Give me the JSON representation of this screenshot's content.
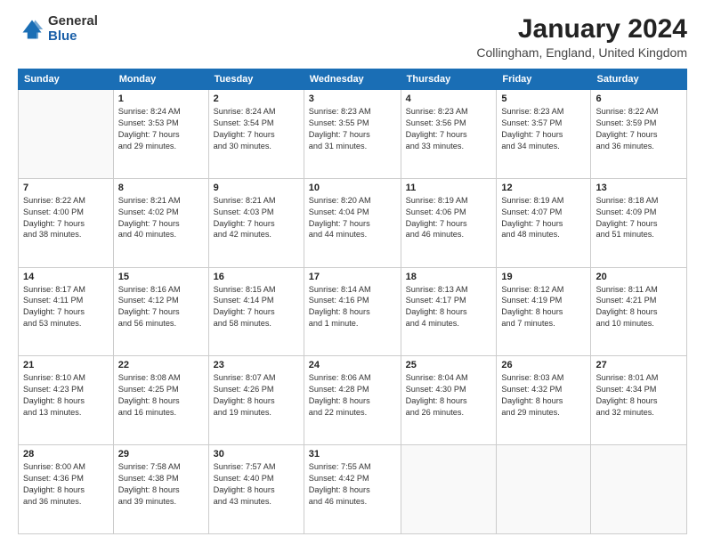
{
  "header": {
    "logo_general": "General",
    "logo_blue": "Blue",
    "month_title": "January 2024",
    "location": "Collingham, England, United Kingdom"
  },
  "days_of_week": [
    "Sunday",
    "Monday",
    "Tuesday",
    "Wednesday",
    "Thursday",
    "Friday",
    "Saturday"
  ],
  "weeks": [
    [
      {
        "day": "",
        "sunrise": "",
        "sunset": "",
        "daylight": ""
      },
      {
        "day": "1",
        "sunrise": "Sunrise: 8:24 AM",
        "sunset": "Sunset: 3:53 PM",
        "daylight": "Daylight: 7 hours and 29 minutes."
      },
      {
        "day": "2",
        "sunrise": "Sunrise: 8:24 AM",
        "sunset": "Sunset: 3:54 PM",
        "daylight": "Daylight: 7 hours and 30 minutes."
      },
      {
        "day": "3",
        "sunrise": "Sunrise: 8:23 AM",
        "sunset": "Sunset: 3:55 PM",
        "daylight": "Daylight: 7 hours and 31 minutes."
      },
      {
        "day": "4",
        "sunrise": "Sunrise: 8:23 AM",
        "sunset": "Sunset: 3:56 PM",
        "daylight": "Daylight: 7 hours and 33 minutes."
      },
      {
        "day": "5",
        "sunrise": "Sunrise: 8:23 AM",
        "sunset": "Sunset: 3:57 PM",
        "daylight": "Daylight: 7 hours and 34 minutes."
      },
      {
        "day": "6",
        "sunrise": "Sunrise: 8:22 AM",
        "sunset": "Sunset: 3:59 PM",
        "daylight": "Daylight: 7 hours and 36 minutes."
      }
    ],
    [
      {
        "day": "7",
        "sunrise": "Sunrise: 8:22 AM",
        "sunset": "Sunset: 4:00 PM",
        "daylight": "Daylight: 7 hours and 38 minutes."
      },
      {
        "day": "8",
        "sunrise": "Sunrise: 8:21 AM",
        "sunset": "Sunset: 4:02 PM",
        "daylight": "Daylight: 7 hours and 40 minutes."
      },
      {
        "day": "9",
        "sunrise": "Sunrise: 8:21 AM",
        "sunset": "Sunset: 4:03 PM",
        "daylight": "Daylight: 7 hours and 42 minutes."
      },
      {
        "day": "10",
        "sunrise": "Sunrise: 8:20 AM",
        "sunset": "Sunset: 4:04 PM",
        "daylight": "Daylight: 7 hours and 44 minutes."
      },
      {
        "day": "11",
        "sunrise": "Sunrise: 8:19 AM",
        "sunset": "Sunset: 4:06 PM",
        "daylight": "Daylight: 7 hours and 46 minutes."
      },
      {
        "day": "12",
        "sunrise": "Sunrise: 8:19 AM",
        "sunset": "Sunset: 4:07 PM",
        "daylight": "Daylight: 7 hours and 48 minutes."
      },
      {
        "day": "13",
        "sunrise": "Sunrise: 8:18 AM",
        "sunset": "Sunset: 4:09 PM",
        "daylight": "Daylight: 7 hours and 51 minutes."
      }
    ],
    [
      {
        "day": "14",
        "sunrise": "Sunrise: 8:17 AM",
        "sunset": "Sunset: 4:11 PM",
        "daylight": "Daylight: 7 hours and 53 minutes."
      },
      {
        "day": "15",
        "sunrise": "Sunrise: 8:16 AM",
        "sunset": "Sunset: 4:12 PM",
        "daylight": "Daylight: 7 hours and 56 minutes."
      },
      {
        "day": "16",
        "sunrise": "Sunrise: 8:15 AM",
        "sunset": "Sunset: 4:14 PM",
        "daylight": "Daylight: 7 hours and 58 minutes."
      },
      {
        "day": "17",
        "sunrise": "Sunrise: 8:14 AM",
        "sunset": "Sunset: 4:16 PM",
        "daylight": "Daylight: 8 hours and 1 minute."
      },
      {
        "day": "18",
        "sunrise": "Sunrise: 8:13 AM",
        "sunset": "Sunset: 4:17 PM",
        "daylight": "Daylight: 8 hours and 4 minutes."
      },
      {
        "day": "19",
        "sunrise": "Sunrise: 8:12 AM",
        "sunset": "Sunset: 4:19 PM",
        "daylight": "Daylight: 8 hours and 7 minutes."
      },
      {
        "day": "20",
        "sunrise": "Sunrise: 8:11 AM",
        "sunset": "Sunset: 4:21 PM",
        "daylight": "Daylight: 8 hours and 10 minutes."
      }
    ],
    [
      {
        "day": "21",
        "sunrise": "Sunrise: 8:10 AM",
        "sunset": "Sunset: 4:23 PM",
        "daylight": "Daylight: 8 hours and 13 minutes."
      },
      {
        "day": "22",
        "sunrise": "Sunrise: 8:08 AM",
        "sunset": "Sunset: 4:25 PM",
        "daylight": "Daylight: 8 hours and 16 minutes."
      },
      {
        "day": "23",
        "sunrise": "Sunrise: 8:07 AM",
        "sunset": "Sunset: 4:26 PM",
        "daylight": "Daylight: 8 hours and 19 minutes."
      },
      {
        "day": "24",
        "sunrise": "Sunrise: 8:06 AM",
        "sunset": "Sunset: 4:28 PM",
        "daylight": "Daylight: 8 hours and 22 minutes."
      },
      {
        "day": "25",
        "sunrise": "Sunrise: 8:04 AM",
        "sunset": "Sunset: 4:30 PM",
        "daylight": "Daylight: 8 hours and 26 minutes."
      },
      {
        "day": "26",
        "sunrise": "Sunrise: 8:03 AM",
        "sunset": "Sunset: 4:32 PM",
        "daylight": "Daylight: 8 hours and 29 minutes."
      },
      {
        "day": "27",
        "sunrise": "Sunrise: 8:01 AM",
        "sunset": "Sunset: 4:34 PM",
        "daylight": "Daylight: 8 hours and 32 minutes."
      }
    ],
    [
      {
        "day": "28",
        "sunrise": "Sunrise: 8:00 AM",
        "sunset": "Sunset: 4:36 PM",
        "daylight": "Daylight: 8 hours and 36 minutes."
      },
      {
        "day": "29",
        "sunrise": "Sunrise: 7:58 AM",
        "sunset": "Sunset: 4:38 PM",
        "daylight": "Daylight: 8 hours and 39 minutes."
      },
      {
        "day": "30",
        "sunrise": "Sunrise: 7:57 AM",
        "sunset": "Sunset: 4:40 PM",
        "daylight": "Daylight: 8 hours and 43 minutes."
      },
      {
        "day": "31",
        "sunrise": "Sunrise: 7:55 AM",
        "sunset": "Sunset: 4:42 PM",
        "daylight": "Daylight: 8 hours and 46 minutes."
      },
      {
        "day": "",
        "sunrise": "",
        "sunset": "",
        "daylight": ""
      },
      {
        "day": "",
        "sunrise": "",
        "sunset": "",
        "daylight": ""
      },
      {
        "day": "",
        "sunrise": "",
        "sunset": "",
        "daylight": ""
      }
    ]
  ]
}
